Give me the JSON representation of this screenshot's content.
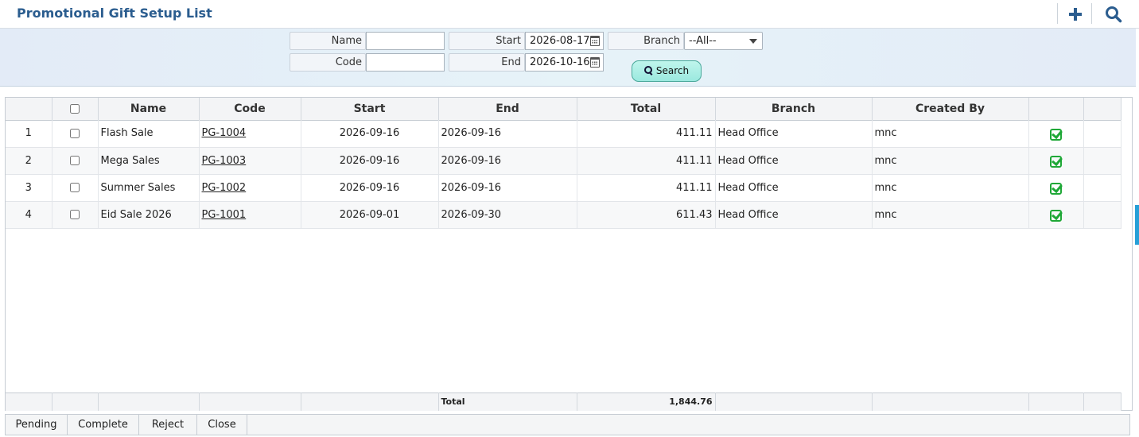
{
  "header": {
    "title": "Promotional Gift Setup List",
    "add_icon": "plus-icon",
    "search_icon": "search-icon"
  },
  "filters": {
    "name_label": "Name",
    "name_value": "",
    "code_label": "Code",
    "code_value": "",
    "start_label": "Start",
    "start_value": "2026-08-17",
    "end_label": "End",
    "end_value": "2026-10-16",
    "branch_label": "Branch",
    "branch_value": "--All--",
    "search_label": "Search"
  },
  "columns": [
    "Name",
    "Code",
    "Start",
    "End",
    "Total",
    "Branch",
    "Created By"
  ],
  "rows": [
    {
      "no": "1",
      "name": "Flash Sale",
      "code": "PG-1004",
      "start": "2026-09-16",
      "end": "2026-09-16",
      "total": "411.11",
      "branch": "Head Office",
      "created_by": "mnc"
    },
    {
      "no": "2",
      "name": "Mega Sales",
      "code": "PG-1003",
      "start": "2026-09-16",
      "end": "2026-09-16",
      "total": "411.11",
      "branch": "Head Office",
      "created_by": "mnc"
    },
    {
      "no": "3",
      "name": "Summer Sales",
      "code": "PG-1002",
      "start": "2026-09-16",
      "end": "2026-09-16",
      "total": "411.11",
      "branch": "Head Office",
      "created_by": "mnc"
    },
    {
      "no": "4",
      "name": "Eid Sale 2026",
      "code": "PG-1001",
      "start": "2026-09-01",
      "end": "2026-09-30",
      "total": "611.43",
      "branch": "Head Office",
      "created_by": "mnc"
    }
  ],
  "footer": {
    "total_label": "Total",
    "total_value": "1,844.76"
  },
  "toolbar": {
    "pending": "Pending",
    "complete": "Complete",
    "reject": "Reject",
    "close": "Close"
  },
  "colors": {
    "title": "#2b5d8f",
    "check": "#1fa837",
    "search_button": "#bff5ec"
  }
}
